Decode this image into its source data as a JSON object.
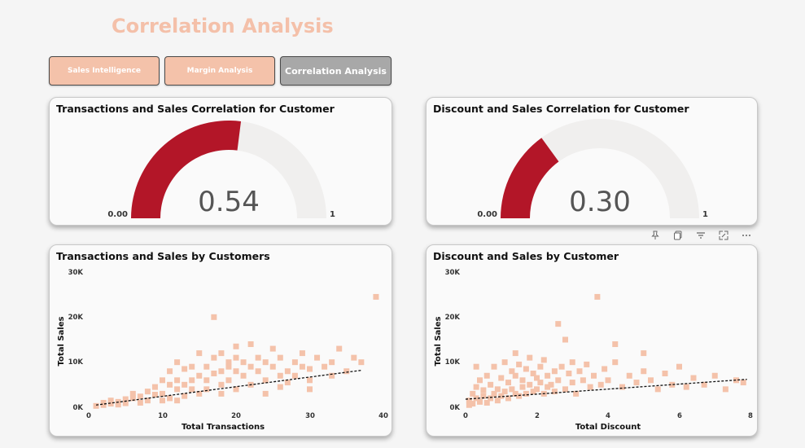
{
  "page": {
    "title": "Correlation Analysis"
  },
  "nav": {
    "buttons": [
      {
        "label": "Sales Intelligence"
      },
      {
        "label": "Margin Analysis"
      },
      {
        "label": "Correlation Analysis"
      }
    ]
  },
  "gauges": [
    {
      "title": "Transactions and Sales Correlation for Customer",
      "value": 0.54,
      "value_label": "0.54",
      "min_label": "0.00",
      "max_label": "1",
      "fill_color": "#b31628",
      "track_color": "#f0efee"
    },
    {
      "title": "Discount and Sales Correlation for Customer",
      "value": 0.3,
      "value_label": "0.30",
      "min_label": "0.00",
      "max_label": "1",
      "fill_color": "#b31628",
      "track_color": "#f0efee"
    }
  ],
  "visual_toolbar": {
    "icons": [
      "pin-icon",
      "copy-icon",
      "filter-icon",
      "focus-mode-icon",
      "more-options-icon"
    ]
  },
  "chart_data": [
    {
      "type": "scatter",
      "title": "Transactions and Sales by Customers",
      "xlabel": "Total Transactions",
      "ylabel": "Total Sales",
      "xlim": [
        0,
        40
      ],
      "ylim": [
        0,
        30000
      ],
      "x_ticks": [
        "0",
        "10",
        "20",
        "30",
        "40"
      ],
      "y_ticks": [
        "0K",
        "10K",
        "20K",
        "30K"
      ],
      "trend_line": [
        [
          1,
          500
        ],
        [
          37,
          8200
        ]
      ],
      "marker_color": "#f4c2aa",
      "points": [
        [
          1,
          300
        ],
        [
          2,
          500
        ],
        [
          2,
          1000
        ],
        [
          3,
          800
        ],
        [
          3,
          1500
        ],
        [
          4,
          1200
        ],
        [
          4,
          600
        ],
        [
          5,
          1800
        ],
        [
          5,
          900
        ],
        [
          6,
          2000
        ],
        [
          6,
          3000
        ],
        [
          7,
          2400
        ],
        [
          7,
          1000
        ],
        [
          8,
          3500
        ],
        [
          8,
          1500
        ],
        [
          9,
          2800
        ],
        [
          9,
          4500
        ],
        [
          10,
          3000
        ],
        [
          10,
          6000
        ],
        [
          10,
          1500
        ],
        [
          11,
          5000
        ],
        [
          11,
          8000
        ],
        [
          11,
          2000
        ],
        [
          12,
          4000
        ],
        [
          12,
          6000
        ],
        [
          12,
          10000
        ],
        [
          13,
          5000
        ],
        [
          13,
          2500
        ],
        [
          13,
          8500
        ],
        [
          14,
          6000
        ],
        [
          14,
          4000
        ],
        [
          14,
          9000
        ],
        [
          15,
          7000
        ],
        [
          15,
          3000
        ],
        [
          15,
          12000
        ],
        [
          16,
          6000
        ],
        [
          16,
          9000
        ],
        [
          16,
          4000
        ],
        [
          17,
          7500
        ],
        [
          17,
          11000
        ],
        [
          17,
          20000
        ],
        [
          18,
          8000
        ],
        [
          18,
          5000
        ],
        [
          18,
          12000
        ],
        [
          19,
          9000
        ],
        [
          19,
          6000
        ],
        [
          19,
          10000
        ],
        [
          20,
          8000
        ],
        [
          20,
          11000
        ],
        [
          20,
          4000
        ],
        [
          20,
          13500
        ],
        [
          21,
          7000
        ],
        [
          21,
          10000
        ],
        [
          22,
          9000
        ],
        [
          22,
          5000
        ],
        [
          22,
          14000
        ],
        [
          23,
          8000
        ],
        [
          23,
          11000
        ],
        [
          24,
          6000
        ],
        [
          24,
          10000
        ],
        [
          25,
          9000
        ],
        [
          25,
          13000
        ],
        [
          26,
          7000
        ],
        [
          26,
          11000
        ],
        [
          27,
          8000
        ],
        [
          27,
          5500
        ],
        [
          28,
          10000
        ],
        [
          28,
          7000
        ],
        [
          29,
          9000
        ],
        [
          29,
          12000
        ],
        [
          30,
          8500
        ],
        [
          30,
          6000
        ],
        [
          31,
          11000
        ],
        [
          32,
          9000
        ],
        [
          33,
          7000
        ],
        [
          33,
          10000
        ],
        [
          34,
          13000
        ],
        [
          35,
          8000
        ],
        [
          36,
          11000
        ],
        [
          37,
          10000
        ],
        [
          39,
          24500
        ],
        [
          30,
          4000
        ],
        [
          24,
          3000
        ],
        [
          12,
          1500
        ],
        [
          18,
          3000
        ],
        [
          26,
          4500
        ]
      ]
    },
    {
      "type": "scatter",
      "title": "Discount and Sales by Customer",
      "xlabel": "Total Discount",
      "ylabel": "Total Sales",
      "xlim": [
        0,
        8
      ],
      "ylim": [
        0,
        30000
      ],
      "x_ticks": [
        "0",
        "2",
        "4",
        "6",
        "8"
      ],
      "y_ticks": [
        "0K",
        "10K",
        "20K",
        "30K"
      ],
      "trend_line": [
        [
          0,
          1800
        ],
        [
          7.9,
          6200
        ]
      ],
      "marker_color": "#f4c2aa",
      "points": [
        [
          0.1,
          500
        ],
        [
          0.1,
          1500
        ],
        [
          0.2,
          3000
        ],
        [
          0.2,
          800
        ],
        [
          0.3,
          2000
        ],
        [
          0.3,
          4500
        ],
        [
          0.4,
          1200
        ],
        [
          0.4,
          6000
        ],
        [
          0.5,
          2500
        ],
        [
          0.5,
          3800
        ],
        [
          0.6,
          1000
        ],
        [
          0.6,
          7000
        ],
        [
          0.7,
          2000
        ],
        [
          0.7,
          5000
        ],
        [
          0.8,
          3000
        ],
        [
          0.8,
          9000
        ],
        [
          0.9,
          1500
        ],
        [
          0.9,
          4000
        ],
        [
          1.0,
          2500
        ],
        [
          1.0,
          6500
        ],
        [
          1.1,
          3500
        ],
        [
          1.1,
          10000
        ],
        [
          1.2,
          2000
        ],
        [
          1.2,
          5500
        ],
        [
          1.3,
          4000
        ],
        [
          1.3,
          8000
        ],
        [
          1.4,
          3000
        ],
        [
          1.4,
          7000
        ],
        [
          1.5,
          2500
        ],
        [
          1.5,
          9500
        ],
        [
          1.6,
          4500
        ],
        [
          1.6,
          6000
        ],
        [
          1.7,
          3000
        ],
        [
          1.7,
          8500
        ],
        [
          1.8,
          5000
        ],
        [
          1.8,
          11000
        ],
        [
          1.9,
          3500
        ],
        [
          1.9,
          7500
        ],
        [
          2.0,
          4000
        ],
        [
          2.0,
          6500
        ],
        [
          2.1,
          5500
        ],
        [
          2.1,
          9000
        ],
        [
          2.2,
          3000
        ],
        [
          2.2,
          10500
        ],
        [
          2.3,
          4500
        ],
        [
          2.3,
          7000
        ],
        [
          2.4,
          5000
        ],
        [
          2.5,
          8000
        ],
        [
          2.5,
          3500
        ],
        [
          2.6,
          6000
        ],
        [
          2.7,
          9000
        ],
        [
          2.8,
          4000
        ],
        [
          2.9,
          7500
        ],
        [
          3.0,
          5500
        ],
        [
          3.0,
          10000
        ],
        [
          3.1,
          3000
        ],
        [
          3.2,
          8000
        ],
        [
          3.3,
          6000
        ],
        [
          3.4,
          9500
        ],
        [
          3.5,
          4500
        ],
        [
          3.6,
          7000
        ],
        [
          3.7,
          24500
        ],
        [
          3.8,
          5000
        ],
        [
          3.9,
          8500
        ],
        [
          4.0,
          6000
        ],
        [
          4.2,
          10000
        ],
        [
          4.4,
          4500
        ],
        [
          4.6,
          7000
        ],
        [
          4.8,
          5500
        ],
        [
          5.0,
          8000
        ],
        [
          5.2,
          6000
        ],
        [
          5.4,
          4000
        ],
        [
          5.6,
          7500
        ],
        [
          5.8,
          5000
        ],
        [
          6.0,
          9000
        ],
        [
          6.2,
          4500
        ],
        [
          6.4,
          6500
        ],
        [
          6.7,
          5000
        ],
        [
          7.0,
          7000
        ],
        [
          7.3,
          4000
        ],
        [
          7.6,
          6000
        ],
        [
          7.8,
          5500
        ],
        [
          2.6,
          18500
        ],
        [
          2.8,
          15000
        ],
        [
          4.2,
          14000
        ],
        [
          5.0,
          12000
        ],
        [
          0.3,
          9000
        ],
        [
          1.4,
          12000
        ]
      ]
    }
  ]
}
